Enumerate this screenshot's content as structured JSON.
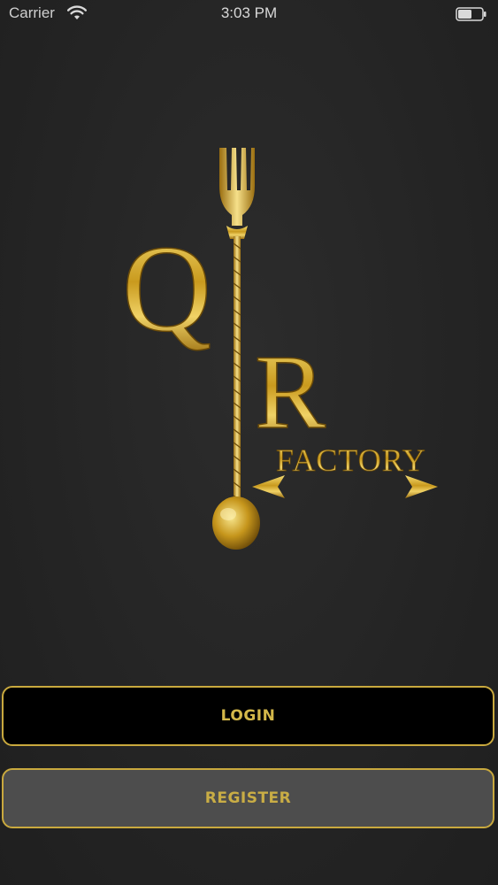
{
  "status_bar": {
    "carrier": "Carrier",
    "time": "3:03 PM",
    "wifi_icon": "wifi-icon",
    "battery_icon": "battery-icon"
  },
  "logo": {
    "letter_q": "Q",
    "letter_r": "R",
    "wordmark": "FACTORY",
    "accent_color": "#c9a93e"
  },
  "buttons": {
    "login_label": "LOGIN",
    "register_label": "REGISTER"
  },
  "colors": {
    "background": "#262626",
    "gold": "#d4b84a",
    "login_bg": "#000000",
    "register_bg": "#4d4d4d"
  }
}
